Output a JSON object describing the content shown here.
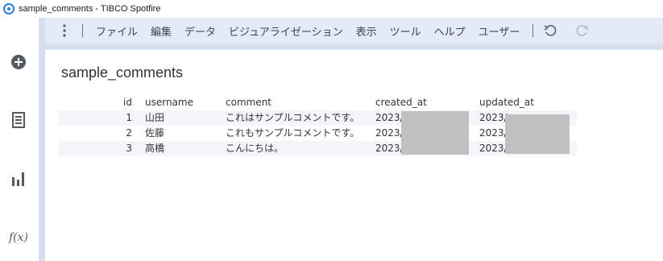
{
  "window": {
    "title": "sample_comments - TIBCO Spotfire"
  },
  "menu": {
    "items": [
      "ファイル",
      "編集",
      "データ",
      "ビジュアライゼーション",
      "表示",
      "ツール",
      "ヘルプ",
      "ユーザー"
    ]
  },
  "toolbar": {
    "more_icon": "kebab-vertical-icon",
    "undo_icon": "undo-icon",
    "redo_icon": "redo-icon"
  },
  "left_rail": {
    "icons": [
      "add-circle-icon",
      "data-table-icon",
      "bar-chart-icon",
      "fx-icon"
    ],
    "fx_label": "f(x)"
  },
  "visualization": {
    "title": "sample_comments",
    "columns": [
      "id",
      "username",
      "comment",
      "created_at",
      "updated_at"
    ],
    "rows": [
      {
        "id": "1",
        "username": "山田",
        "comment": "これはサンプルコメントです。",
        "created_at": "2023/",
        "updated_at": "2023/"
      },
      {
        "id": "2",
        "username": "佐藤",
        "comment": "これもサンプルコメントです。",
        "created_at": "2023/",
        "updated_at": "2023/"
      },
      {
        "id": "3",
        "username": "高橋",
        "comment": "こんにちは。",
        "created_at": "2023/",
        "updated_at": "2023/"
      }
    ]
  },
  "colors": {
    "accent": "#2c7bd6",
    "menubar_bg": "#e4eaf6",
    "redaction": "#c0c0c0"
  }
}
